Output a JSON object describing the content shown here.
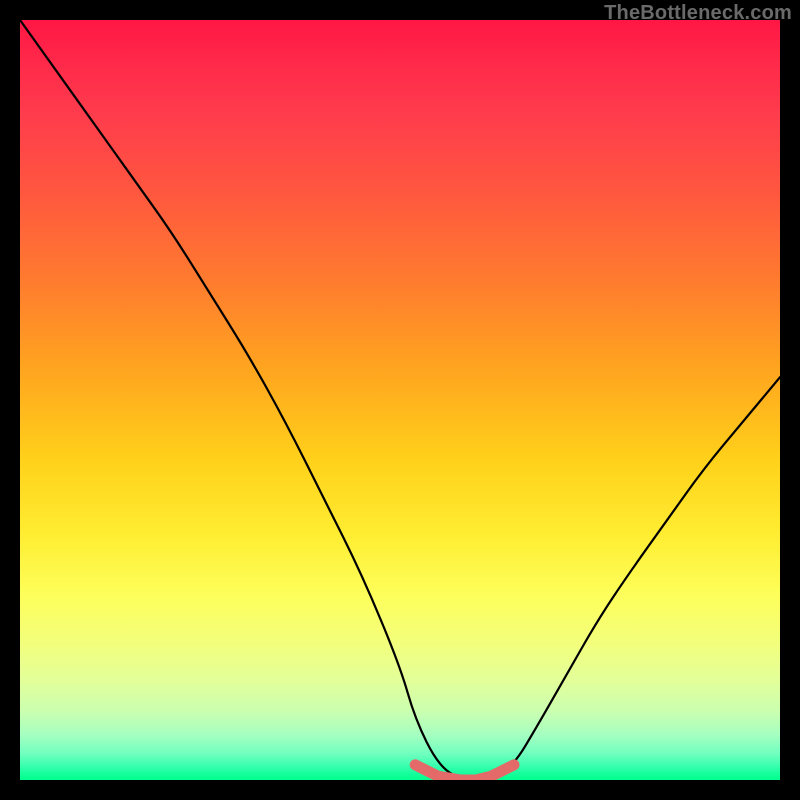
{
  "watermark": "TheBottleneck.com",
  "chart_data": {
    "type": "line",
    "title": "",
    "xlabel": "",
    "ylabel": "",
    "xlim": [
      0,
      100
    ],
    "ylim": [
      0,
      100
    ],
    "series": [
      {
        "name": "bottleneck-curve",
        "x": [
          0,
          5,
          10,
          15,
          20,
          25,
          30,
          35,
          40,
          45,
          50,
          52,
          55,
          58,
          60,
          62,
          65,
          68,
          72,
          76,
          80,
          85,
          90,
          95,
          100
        ],
        "values": [
          100,
          93,
          86,
          79,
          72,
          64,
          56,
          47,
          37,
          27,
          15,
          8,
          2,
          0,
          0,
          0,
          2,
          7,
          14,
          21,
          27,
          34,
          41,
          47,
          53
        ]
      },
      {
        "name": "optimal-zone-marker",
        "x": [
          52,
          55,
          58,
          60,
          62,
          65
        ],
        "values": [
          2,
          0.5,
          0,
          0,
          0.5,
          2
        ]
      }
    ],
    "colors": {
      "curve": "#000000",
      "marker": "#e46a6a",
      "gradient_top": "#ff1744",
      "gradient_bottom": "#00ff8c"
    }
  }
}
